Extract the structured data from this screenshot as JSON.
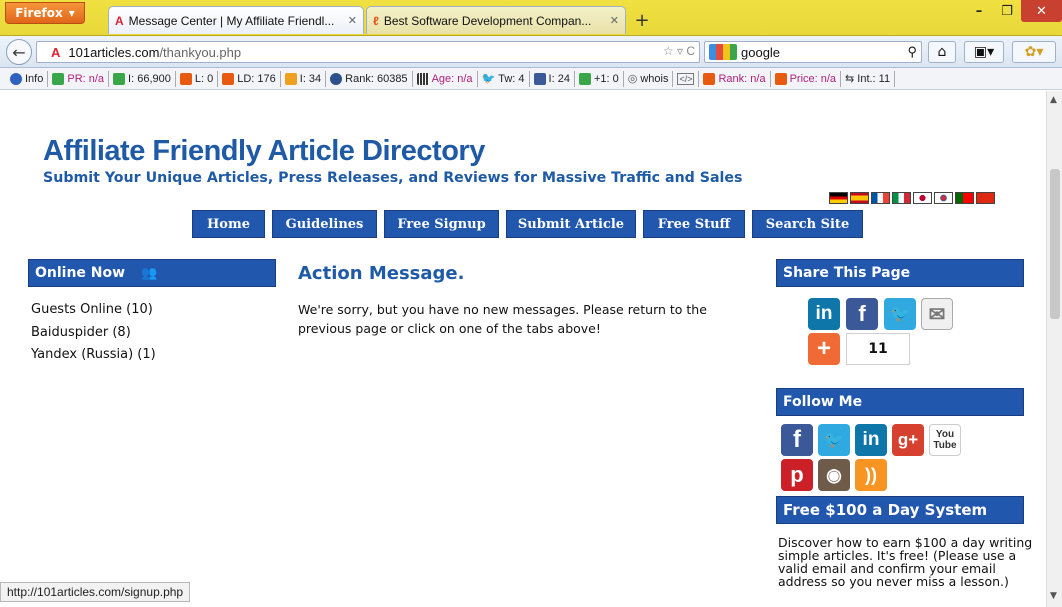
{
  "browser": {
    "app_button_label": "Firefox",
    "tabs": [
      {
        "title": "Message Center | My Affiliate Friendl...",
        "active": true
      },
      {
        "title": "Best Software Development Compan...",
        "active": false
      }
    ],
    "new_tab_label": "+",
    "url_domain": "101articles.com",
    "url_path": "/thankyou.php",
    "search_value": "google",
    "window_controls": {
      "minimize": "–",
      "maximize": "❐",
      "close": "✕"
    }
  },
  "seo_toolbar": [
    {
      "label": "Info",
      "color": "#3060c0"
    },
    {
      "label": "PR: n/a",
      "color": "#3aa64a",
      "pink": true
    },
    {
      "label": "I: 66,900",
      "color": "#3aa64a"
    },
    {
      "label": "L: 0",
      "color": "#e85a10"
    },
    {
      "label": "LD: 176",
      "color": "#e85a10"
    },
    {
      "label": "I: 34",
      "color": "#f0a020"
    },
    {
      "label": "Rank: 60385",
      "color": "#2d4f8a"
    },
    {
      "label": "Age: n/a",
      "color": "#333333",
      "pink": true
    },
    {
      "label": "Tw: 4",
      "color": "#2fa9e0"
    },
    {
      "label": "I: 24",
      "color": "#3b5998"
    },
    {
      "label": "+1: 0",
      "color": "#3aa64a"
    },
    {
      "label": "whois",
      "color": "#555555"
    },
    {
      "label": "",
      "color": "#777777"
    },
    {
      "label": "Rank: n/a",
      "color": "#e85a10",
      "pink": true
    },
    {
      "label": "Price: n/a",
      "color": "#e85a10",
      "pink": true
    },
    {
      "label": "Int.: 11",
      "color": "#333333"
    }
  ],
  "site": {
    "title": "Affiliate Friendly Article Directory",
    "subtitle": "Submit Your Unique Articles, Press Releases, and Reviews for Massive Traffic and Sales",
    "flags": [
      "de",
      "es",
      "fr",
      "it",
      "jp",
      "kr",
      "pt",
      "cn"
    ],
    "menu": [
      "Home",
      "Guidelines",
      "Free Signup",
      "Submit Article",
      "Free Stuff",
      "Search Site"
    ]
  },
  "online_now": {
    "heading": "Online Now",
    "items": [
      "Guests Online (10)",
      "Baiduspider (8)",
      "Yandex (Russia) (1)"
    ]
  },
  "main": {
    "heading": "Action Message.",
    "message": "We're sorry, but you have no new messages. Please return to the previous page or click on one of the tabs above!"
  },
  "share": {
    "heading": "Share This Page",
    "count": "11",
    "buttons": [
      "linkedin",
      "facebook",
      "twitter",
      "email",
      "addthis"
    ]
  },
  "follow": {
    "heading": "Follow Me",
    "buttons": [
      "facebook",
      "twitter",
      "linkedin",
      "google-plus",
      "youtube",
      "pinterest",
      "instagram",
      "rss"
    ],
    "youtube_label": "You Tube"
  },
  "free_system": {
    "heading": "Free $100 a Day System",
    "text": "Discover how to earn $100 a day writing simple articles. It's free! (Please use a valid email and confirm your email address so you never miss a lesson.)"
  },
  "status_url": "http://101articles.com/signup.php"
}
